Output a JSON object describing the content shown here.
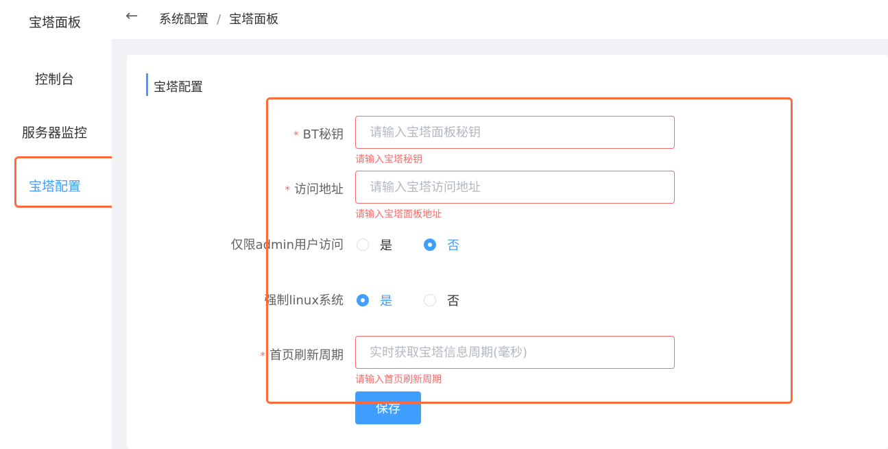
{
  "app": {
    "title": "宝塔面板"
  },
  "breadcrumb": [
    "系统配置",
    "宝塔面板"
  ],
  "sidebar": {
    "items": [
      {
        "label": "控制台"
      },
      {
        "label": "服务器监控"
      },
      {
        "label": "宝塔配置",
        "active": true
      }
    ]
  },
  "section": {
    "title": "宝塔配置"
  },
  "form": {
    "bt_key": {
      "label": "BT秘钥",
      "placeholder": "请输入宝塔面板秘钥",
      "value": "",
      "error": "请输入宝塔秘钥"
    },
    "address": {
      "label": "访问地址",
      "placeholder": "请输入宝塔访问地址",
      "value": "",
      "error": "请输入宝塔面板地址"
    },
    "admin_only": {
      "label": "仅限admin用户访问",
      "options": [
        "是",
        "否"
      ],
      "selected": "否"
    },
    "force_linux": {
      "label": "强制linux系统",
      "options": [
        "是",
        "否"
      ],
      "selected": "是"
    },
    "refresh_period": {
      "label": "首页刷新周期",
      "placeholder": "实时获取宝塔信息周期(毫秒)",
      "value": "",
      "error": "请输入首页刷新周期"
    },
    "save_label": "保存",
    "required_mark": "*"
  },
  "colors": {
    "primary": "#409eff",
    "error": "#f56c6c",
    "highlight": "#ff6a3d"
  }
}
